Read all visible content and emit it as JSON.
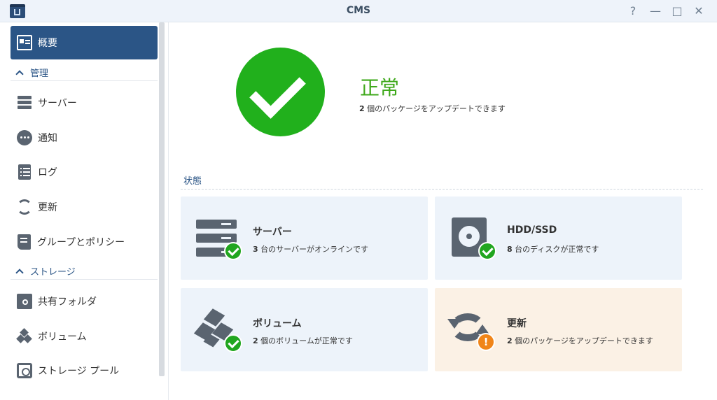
{
  "window": {
    "title": "CMS",
    "help": "?",
    "minimize": "—",
    "maximize": "□",
    "close": "✕"
  },
  "sidebar": {
    "overview": "概要",
    "sections": {
      "manage": "管理",
      "storage": "ストレージ"
    },
    "items": {
      "server": "サーバー",
      "notification": "通知",
      "log": "ログ",
      "update": "更新",
      "group_policy": "グループとポリシー",
      "shared_folder": "共有フォルダ",
      "volume": "ボリューム",
      "storage_pool": "ストレージ プール"
    }
  },
  "status": {
    "title": "正常",
    "count": "2",
    "message": " 個のパッケージをアップデートできます"
  },
  "state_section": {
    "label": "状態"
  },
  "tiles": {
    "server": {
      "title": "サーバー",
      "count": "3",
      "text": " 台のサーバーがオンラインです",
      "badge": "ok"
    },
    "hdd": {
      "title": "HDD/SSD",
      "count": "8",
      "text": " 台のディスクが正常です",
      "badge": "ok"
    },
    "volume": {
      "title": "ボリューム",
      "count": "2",
      "text": " 個のボリュームが正常です",
      "badge": "ok"
    },
    "update": {
      "title": "更新",
      "count": "2",
      "text": " 個のパッケージをアップデートできます",
      "badge": "warn",
      "badge_glyph": "!"
    }
  },
  "colors": {
    "accent": "#2b5586",
    "ok": "#21b01c",
    "warn": "#f08519"
  }
}
